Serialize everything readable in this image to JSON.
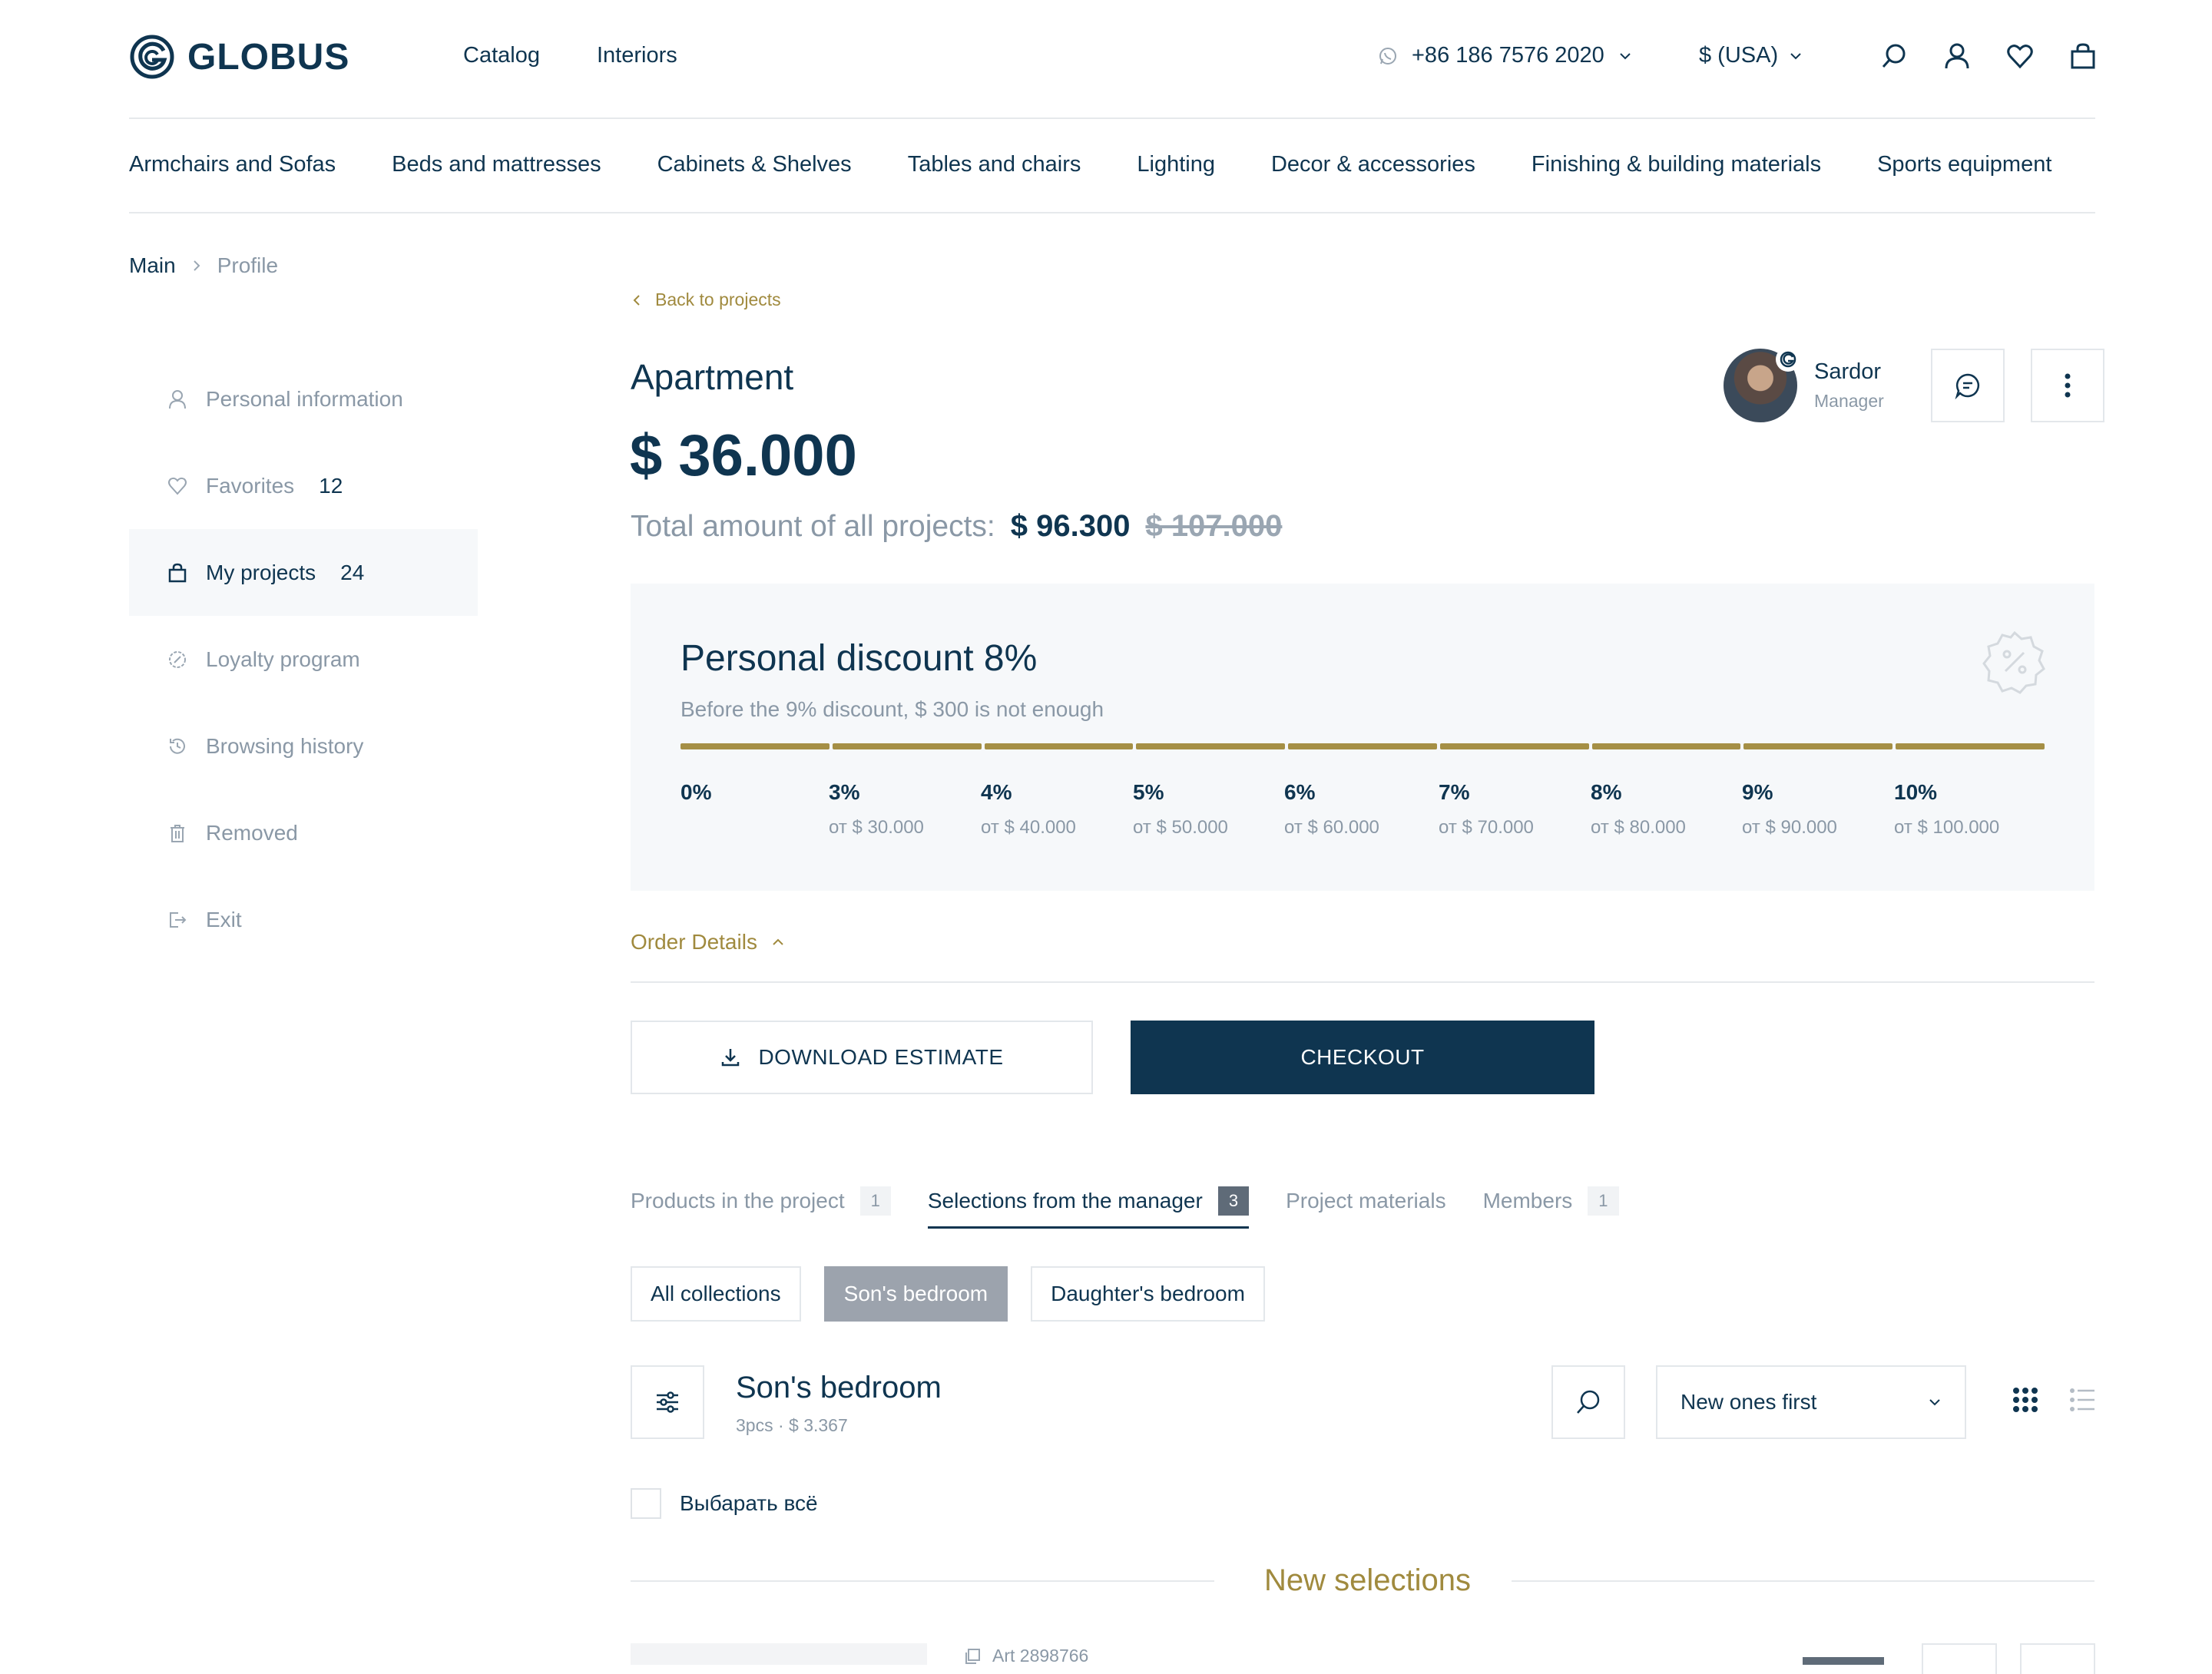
{
  "header": {
    "logo_text": "GLOBUS",
    "nav": [
      "Catalog",
      "Interiors"
    ],
    "phone": "+86 186 7576 2020",
    "currency": "$ (USA)"
  },
  "categories": [
    "Armchairs and Sofas",
    "Beds and mattresses",
    "Cabinets & Shelves",
    "Tables and chairs",
    "Lighting",
    "Decor & accessories",
    "Finishing & building materials",
    "Sports equipment"
  ],
  "breadcrumb": {
    "main": "Main",
    "current": "Profile"
  },
  "sidebar": {
    "items": [
      {
        "label": "Personal information",
        "count": ""
      },
      {
        "label": "Favorites",
        "count": "12"
      },
      {
        "label": "My projects",
        "count": "24"
      },
      {
        "label": "Loyalty program",
        "count": ""
      },
      {
        "label": "Browsing history",
        "count": ""
      },
      {
        "label": "Removed",
        "count": ""
      },
      {
        "label": "Exit",
        "count": ""
      }
    ]
  },
  "project": {
    "back_label": "Back to projects",
    "title": "Apartment",
    "price": "$ 36.000",
    "total_label": "Total amount of all projects:",
    "total_value": "$ 96.300",
    "total_old": "$ 107.000"
  },
  "manager": {
    "name": "Sardor",
    "role": "Manager"
  },
  "discount": {
    "title": "Personal discount 8%",
    "subtitle": "Before the 9% discount, $ 300 is not enough",
    "progress_segments_filled": 9,
    "steps": [
      {
        "pct": "0%",
        "from": ""
      },
      {
        "pct": "3%",
        "from": "от $ 30.000"
      },
      {
        "pct": "4%",
        "from": "от $ 40.000"
      },
      {
        "pct": "5%",
        "from": "от $ 50.000"
      },
      {
        "pct": "6%",
        "from": "от $ 60.000"
      },
      {
        "pct": "7%",
        "from": "от $ 70.000"
      },
      {
        "pct": "8%",
        "from": "от $ 80.000"
      },
      {
        "pct": "9%",
        "from": "от $ 90.000"
      },
      {
        "pct": "10%",
        "from": "от $ 100.000"
      }
    ]
  },
  "order_details_label": "Order Details",
  "buttons": {
    "download": "DOWNLOAD ESTIMATE",
    "checkout": "CHECKOUT"
  },
  "tabs": [
    {
      "label": "Products in the project",
      "count": "1"
    },
    {
      "label": "Selections from the manager",
      "count": "3"
    },
    {
      "label": "Project materials",
      "count": ""
    },
    {
      "label": "Members",
      "count": "1"
    }
  ],
  "chips": [
    "All collections",
    "Son's bedroom",
    "Daughter's bedroom"
  ],
  "section": {
    "title": "Son's bedroom",
    "subtitle": "3pcs · $ 3.367"
  },
  "sort": {
    "value": "New ones first"
  },
  "select_all": "Выбарать всё",
  "new_selections": "New selections",
  "product": {
    "art": "Art 2898766"
  },
  "colors": {
    "primary": "#0f3550",
    "accent": "#a58f45",
    "muted": "#8a98a6"
  }
}
